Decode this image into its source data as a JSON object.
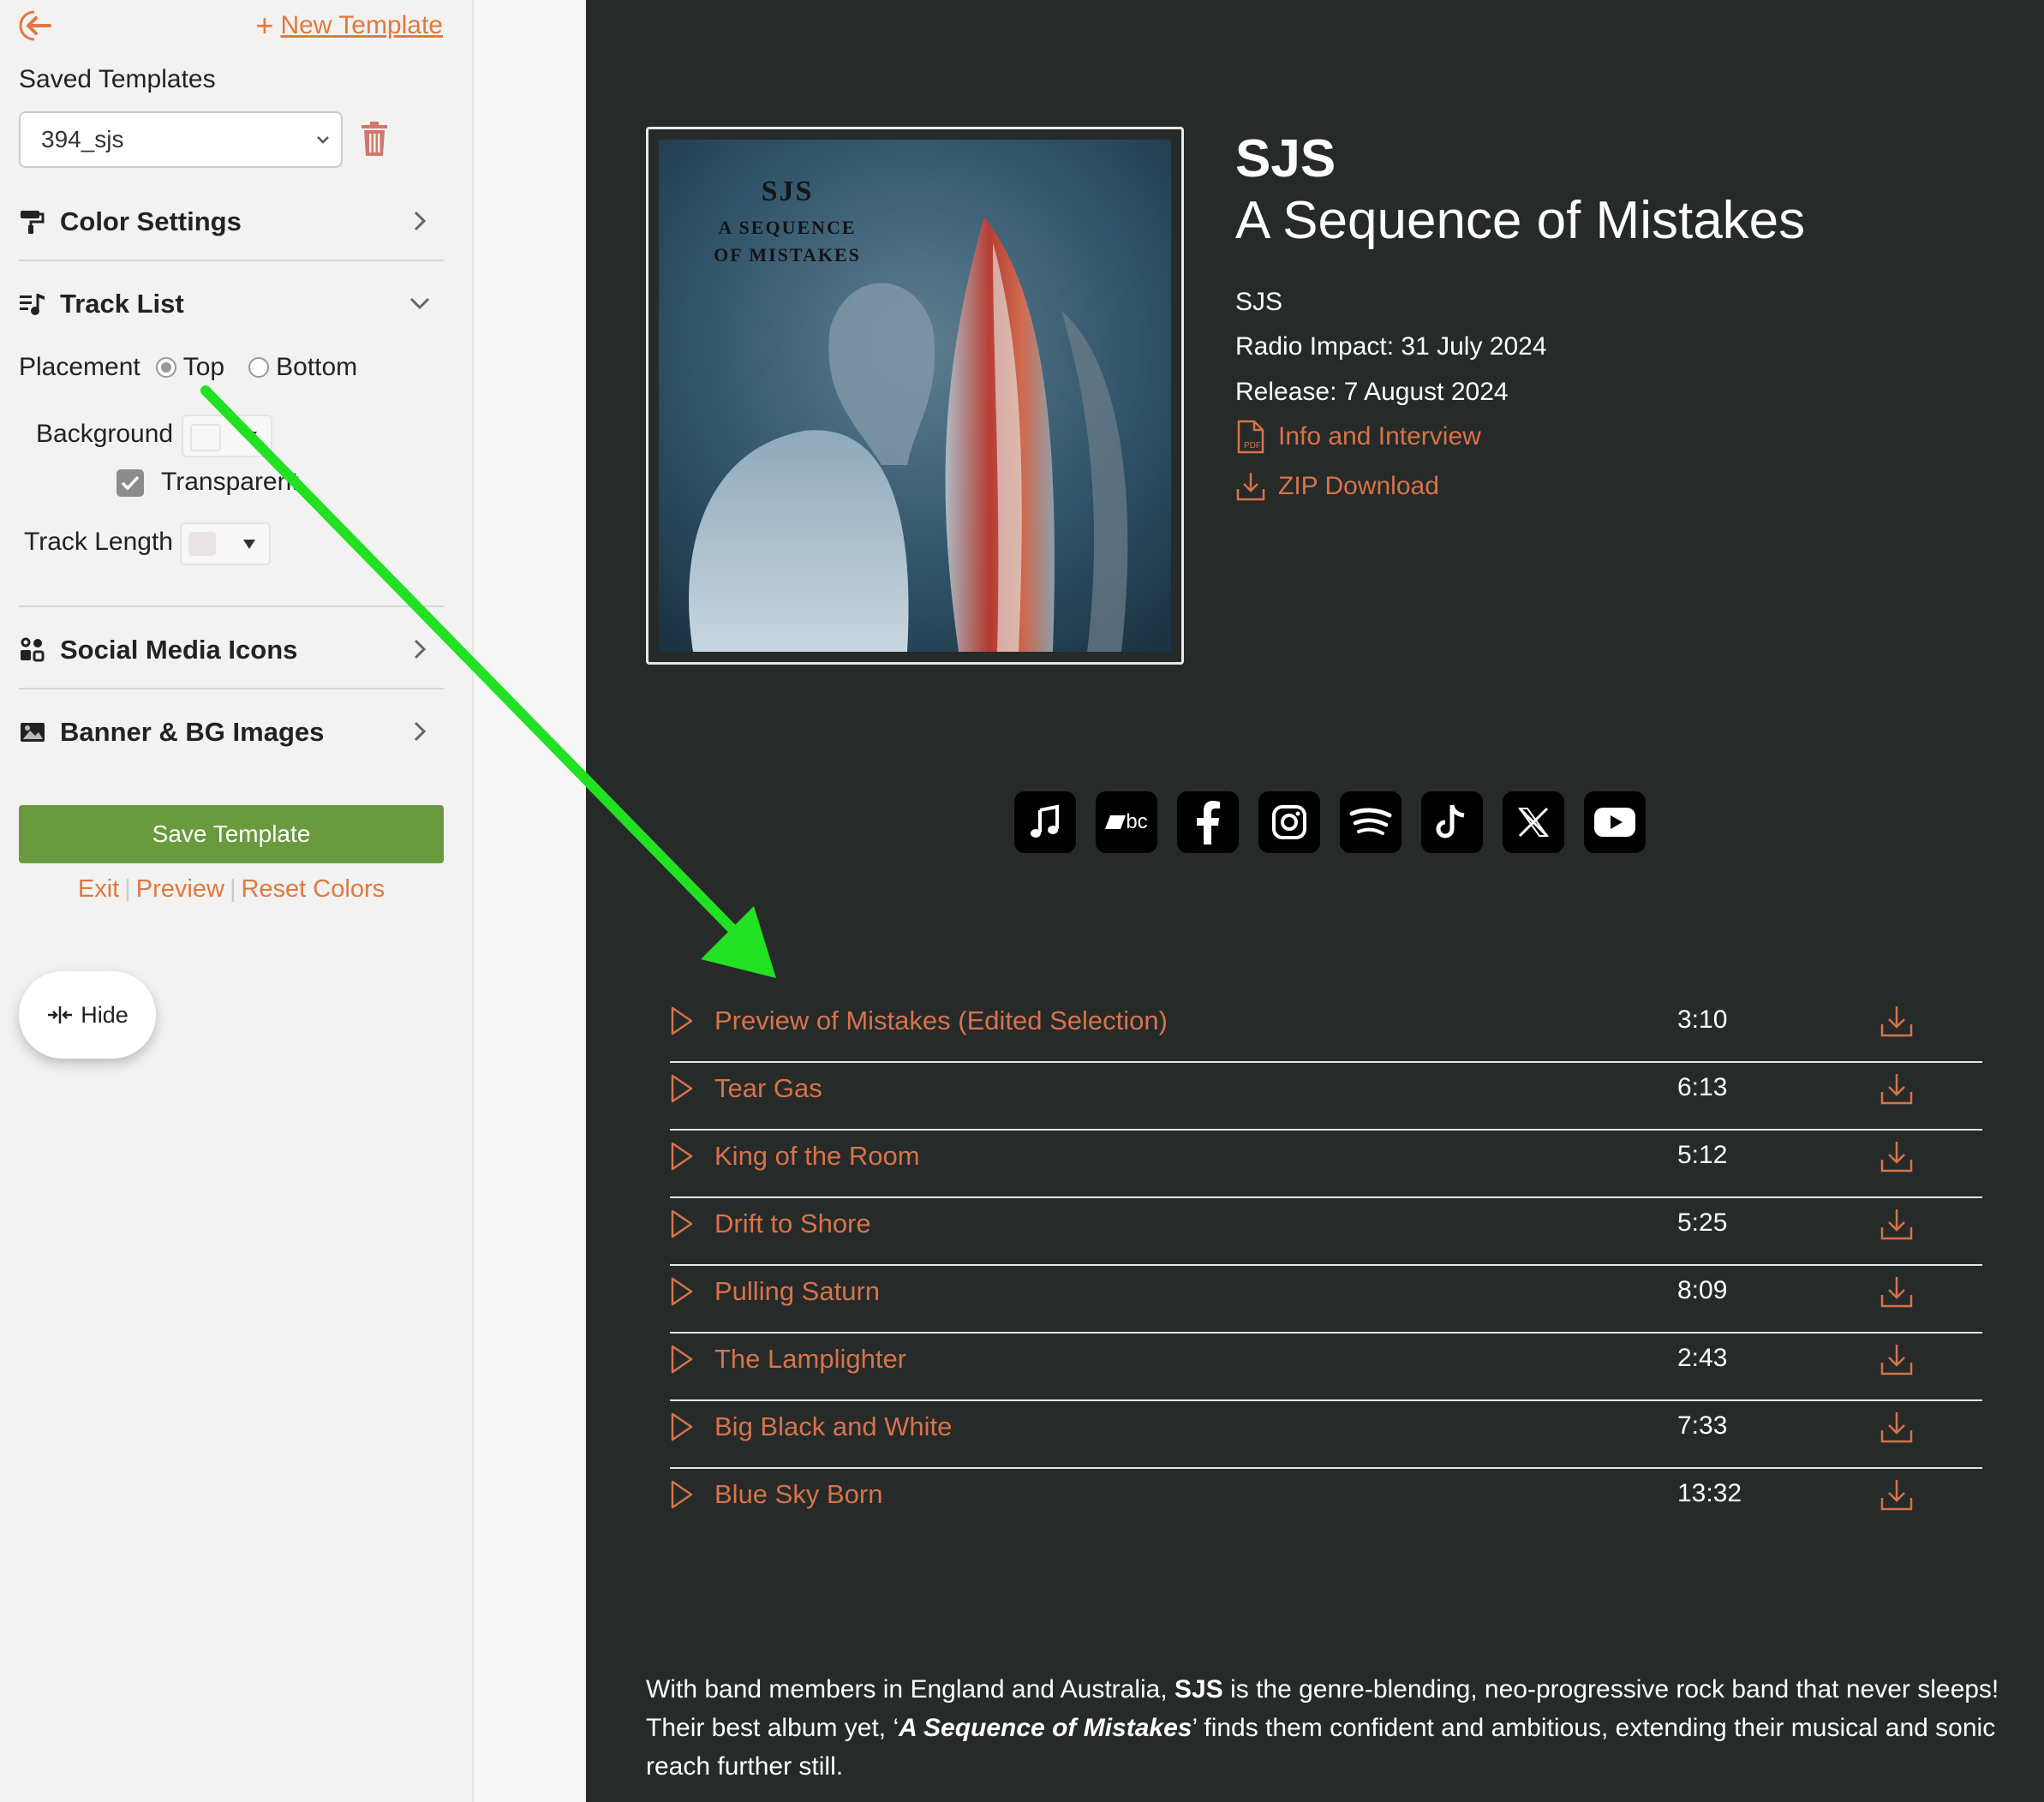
{
  "sidebar": {
    "new_template_label": "New Template",
    "saved_templates_label": "Saved Templates",
    "template_select_value": "394_sjs",
    "sections": {
      "color_settings": "Color Settings",
      "track_list": "Track List",
      "social_media_icons": "Social Media Icons",
      "banner_bg_images": "Banner & BG Images"
    },
    "track_list": {
      "placement_label": "Placement",
      "placement_options": [
        "Top",
        "Bottom"
      ],
      "placement_selected": "Top",
      "background_label": "Background",
      "transparent_label": "Transparent",
      "transparent_checked": true,
      "track_length_label": "Track Length"
    },
    "save_button": "Save Template",
    "links": [
      "Exit",
      "Preview",
      "Reset Colors"
    ],
    "hide_button": "Hide"
  },
  "colors": {
    "accent": "#e0783f",
    "save_button": "#6a9a3e",
    "preview_bg": "#262a29",
    "link": "#d7734a"
  },
  "preview": {
    "cover": {
      "band": "SJS",
      "line1": "A SEQUENCE",
      "line2": "OF MISTAKES"
    },
    "artist": "SJS",
    "album": "A Sequence of Mistakes",
    "artist_line": "SJS",
    "radio_impact": "Radio Impact: 31 July 2024",
    "release": "Release: 7 August 2024",
    "info_link": "Info and Interview",
    "zip_link": "ZIP Download",
    "social_icons": [
      "apple-music-icon",
      "bandcamp-icon",
      "facebook-icon",
      "instagram-icon",
      "spotify-icon",
      "tiktok-icon",
      "x-icon",
      "youtube-icon"
    ],
    "bandcamp_text": "bc",
    "tracks": [
      {
        "title": "Preview of Mistakes (Edited Selection)",
        "length": "3:10"
      },
      {
        "title": "Tear Gas",
        "length": "6:13"
      },
      {
        "title": "King of the Room",
        "length": "5:12"
      },
      {
        "title": "Drift to Shore",
        "length": "5:25"
      },
      {
        "title": "Pulling Saturn",
        "length": "8:09"
      },
      {
        "title": "The Lamplighter",
        "length": "2:43"
      },
      {
        "title": "Big Black and White",
        "length": "7:33"
      },
      {
        "title": "Blue Sky Born",
        "length": "13:32"
      }
    ],
    "bio": {
      "p1": "With band members in England and Australia, ",
      "p1_bold": "SJS",
      "p2": " is the genre-blending, neo-progressive rock band that never sleeps! Their best album yet, ‘",
      "album_italic": "A Sequence of Mistakes",
      "p3": "’ finds them confident and ambitious, extending their musical and sonic reach further still."
    }
  }
}
